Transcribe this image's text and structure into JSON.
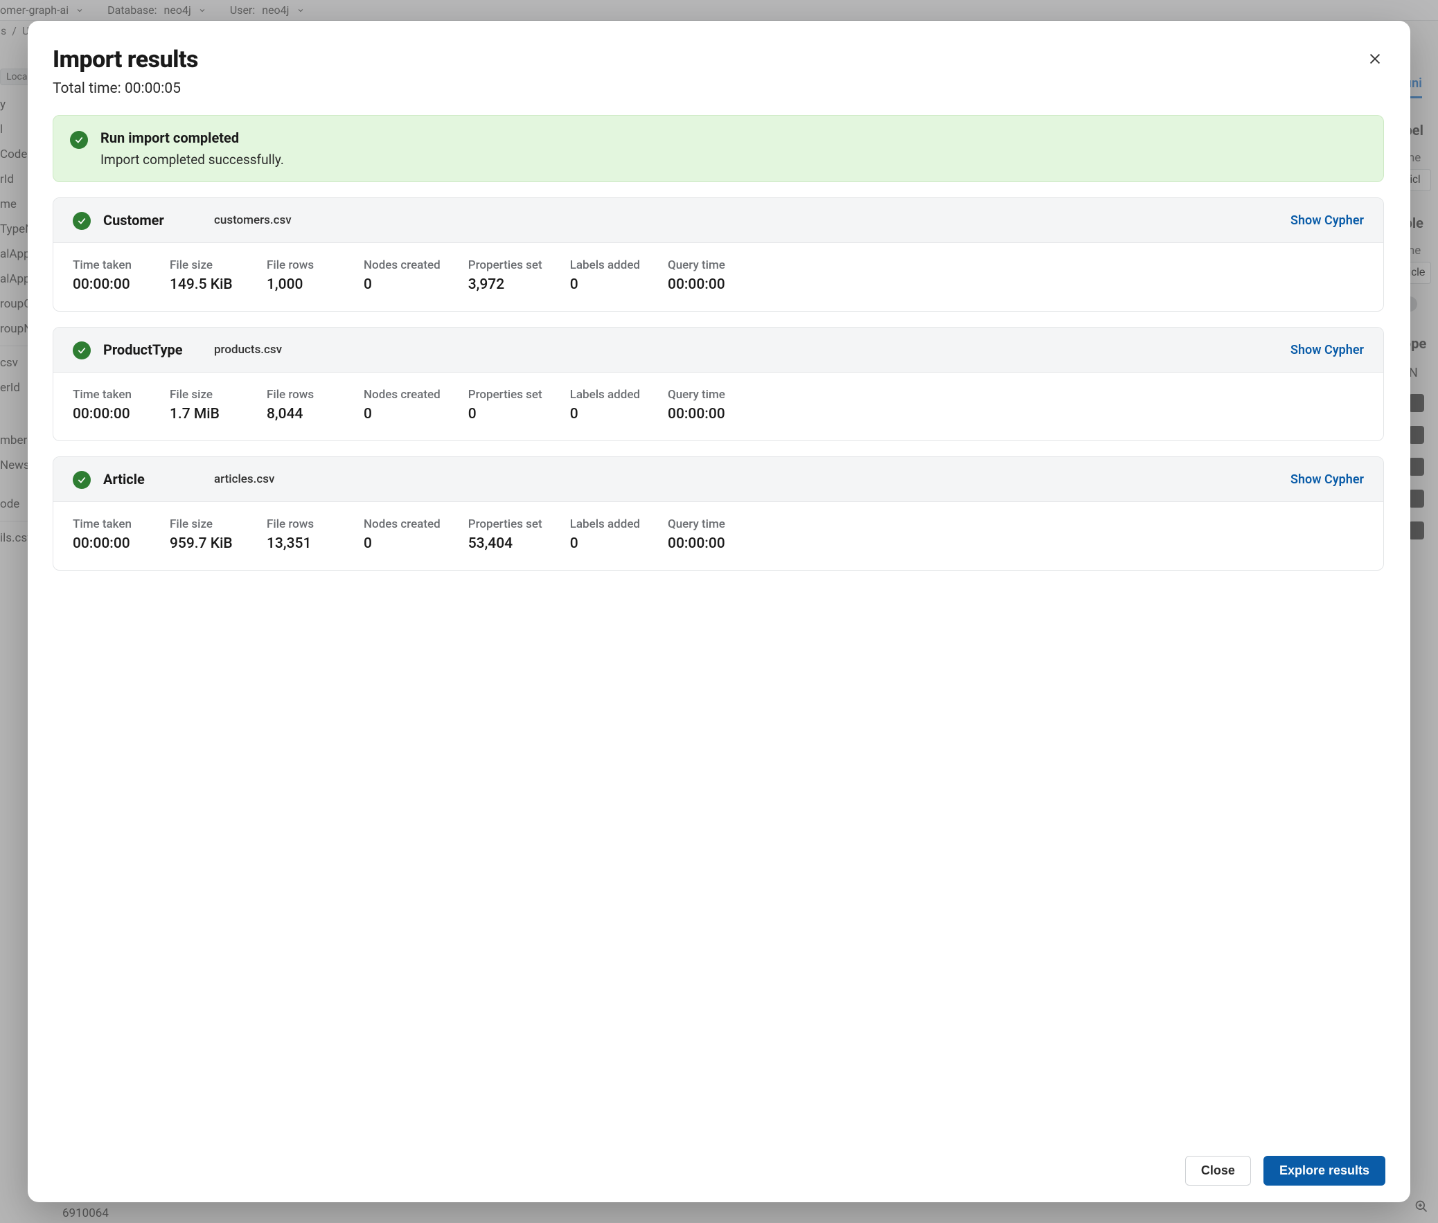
{
  "topbar": {
    "instance": "omer-graph-ai",
    "db_label": "Database:",
    "db_value": "neo4j",
    "user_label": "User:",
    "user_value": "neo4j"
  },
  "breadcrumbs": {
    "a": "s",
    "sep": "/",
    "b": "Ur"
  },
  "left_panel": {
    "pill": "Loca",
    "items": [
      "y",
      "l",
      "Code",
      "rId",
      "me",
      "TypeN",
      "alApp",
      "alApp",
      "roupC",
      "roupN"
    ],
    "sep_items": [
      "csv",
      "erId"
    ],
    "items2": [
      "mberS",
      "Newsl",
      "ode"
    ],
    "file": "ils.csv"
  },
  "right_panel": {
    "tab": "Defini",
    "label_section": "Label",
    "name1_label": "Name",
    "name1_value": "Articl",
    "table_section": "Table",
    "name2_label": "Name",
    "name2_value": "article",
    "prop_section": "Prope",
    "prop_first": "N"
  },
  "bottom_code": "6910064",
  "modal": {
    "title": "Import results",
    "subtitle_prefix": "Total time: ",
    "subtitle_value": "00:00:05",
    "banner": {
      "title": "Run import completed",
      "message": "Import completed successfully."
    },
    "show_cypher_label": "Show Cypher",
    "metric_labels": {
      "time_taken": "Time taken",
      "file_size": "File size",
      "file_rows": "File rows",
      "nodes_created": "Nodes created",
      "properties_set": "Properties set",
      "labels_added": "Labels added",
      "query_time": "Query time"
    },
    "cards": [
      {
        "name": "Customer",
        "file": "customers.csv",
        "time_taken": "00:00:00",
        "file_size": "149.5 KiB",
        "file_rows": "1,000",
        "nodes_created": "0",
        "properties_set": "3,972",
        "labels_added": "0",
        "query_time": "00:00:00"
      },
      {
        "name": "ProductType",
        "file": "products.csv",
        "time_taken": "00:00:00",
        "file_size": "1.7 MiB",
        "file_rows": "8,044",
        "nodes_created": "0",
        "properties_set": "0",
        "labels_added": "0",
        "query_time": "00:00:00"
      },
      {
        "name": "Article",
        "file": "articles.csv",
        "time_taken": "00:00:00",
        "file_size": "959.7 KiB",
        "file_rows": "13,351",
        "nodes_created": "0",
        "properties_set": "53,404",
        "labels_added": "0",
        "query_time": "00:00:00"
      }
    ],
    "footer": {
      "close": "Close",
      "explore": "Explore results"
    }
  }
}
